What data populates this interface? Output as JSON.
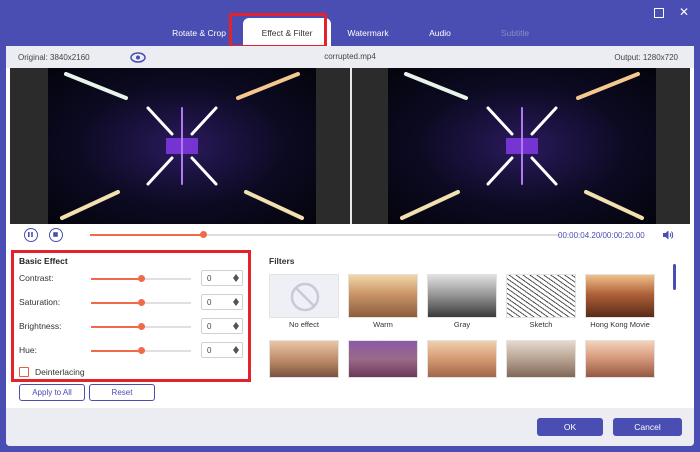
{
  "window": {
    "minimize_icon": "minimize-box-icon",
    "close_icon": "close-icon"
  },
  "tabs": [
    {
      "label": "Rotate & Crop",
      "state": "normal"
    },
    {
      "label": "Effect & Filter",
      "state": "active"
    },
    {
      "label": "Watermark",
      "state": "normal"
    },
    {
      "label": "Audio",
      "state": "normal"
    },
    {
      "label": "Subtitle",
      "state": "disabled"
    }
  ],
  "preview": {
    "original": "Original: 3840x2160",
    "filename": "corrupted.mp4",
    "output": "Output: 1280x720"
  },
  "player": {
    "progress_fraction": 0.24,
    "time": "00:00:04.20/00:00:20.00"
  },
  "basic_effect": {
    "title": "Basic Effect",
    "params": [
      {
        "label": "Contrast:",
        "value": "0",
        "level": 0.5
      },
      {
        "label": "Saturation:",
        "value": "0",
        "level": 0.5
      },
      {
        "label": "Brightness:",
        "value": "0",
        "level": 0.5
      },
      {
        "label": "Hue:",
        "value": "0",
        "level": 0.5
      }
    ],
    "deinterlacing_label": "Deinterlacing",
    "deinterlacing_checked": false,
    "apply_all": "Apply to All",
    "reset": "Reset"
  },
  "filters": {
    "title": "Filters",
    "items": [
      {
        "label": "No effect"
      },
      {
        "label": "Warm"
      },
      {
        "label": "Gray"
      },
      {
        "label": "Sketch"
      },
      {
        "label": "Hong Kong Movie"
      },
      {
        "label": ""
      },
      {
        "label": ""
      },
      {
        "label": ""
      },
      {
        "label": ""
      },
      {
        "label": ""
      }
    ]
  },
  "footer": {
    "ok": "OK",
    "cancel": "Cancel"
  },
  "colors": {
    "accent": "#4a4db2",
    "slider": "#f06a4a",
    "highlight": "#e3232b"
  }
}
